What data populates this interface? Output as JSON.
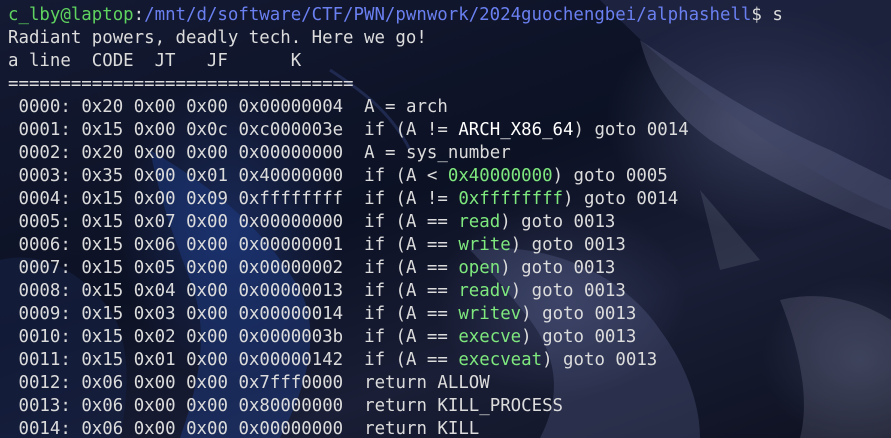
{
  "terminal": {
    "prompt": {
      "user_host": "c_lby@laptop",
      "colon": ":",
      "path": "/mnt/d/software/CTF/PWN/pwnwork/2024guochengbei/alphashell",
      "dollar": "$ ",
      "command": "s"
    },
    "banner": "Radiant powers, deadly tech. Here we go!",
    "header": "a line  CODE  JT   JF      K",
    "separator": "=================================",
    "rows": [
      {
        "num": " 0000:",
        "code": "0x20",
        "jt": "0x00",
        "jf": "0x00",
        "k": "0x00000004",
        "pre": "A = arch",
        "hl": "",
        "post": "",
        "hl_color": "none"
      },
      {
        "num": " 0001:",
        "code": "0x15",
        "jt": "0x00",
        "jf": "0x0c",
        "k": "0xc000003e",
        "pre": "if (A != ",
        "hl": "ARCH_X86_64",
        "post": ") goto 0014",
        "hl_color": "white"
      },
      {
        "num": " 0002:",
        "code": "0x20",
        "jt": "0x00",
        "jf": "0x00",
        "k": "0x00000000",
        "pre": "A = sys_number",
        "hl": "",
        "post": "",
        "hl_color": "none"
      },
      {
        "num": " 0003:",
        "code": "0x35",
        "jt": "0x00",
        "jf": "0x01",
        "k": "0x40000000",
        "pre": "if (A < ",
        "hl": "0x40000000",
        "post": ") goto 0005",
        "hl_color": "green"
      },
      {
        "num": " 0004:",
        "code": "0x15",
        "jt": "0x00",
        "jf": "0x09",
        "k": "0xffffffff",
        "pre": "if (A != ",
        "hl": "0xffffffff",
        "post": ") goto 0014",
        "hl_color": "green"
      },
      {
        "num": " 0005:",
        "code": "0x15",
        "jt": "0x07",
        "jf": "0x00",
        "k": "0x00000000",
        "pre": "if (A == ",
        "hl": "read",
        "post": ") goto 0013",
        "hl_color": "green"
      },
      {
        "num": " 0006:",
        "code": "0x15",
        "jt": "0x06",
        "jf": "0x00",
        "k": "0x00000001",
        "pre": "if (A == ",
        "hl": "write",
        "post": ") goto 0013",
        "hl_color": "green"
      },
      {
        "num": " 0007:",
        "code": "0x15",
        "jt": "0x05",
        "jf": "0x00",
        "k": "0x00000002",
        "pre": "if (A == ",
        "hl": "open",
        "post": ") goto 0013",
        "hl_color": "green"
      },
      {
        "num": " 0008:",
        "code": "0x15",
        "jt": "0x04",
        "jf": "0x00",
        "k": "0x00000013",
        "pre": "if (A == ",
        "hl": "readv",
        "post": ") goto 0013",
        "hl_color": "green"
      },
      {
        "num": " 0009:",
        "code": "0x15",
        "jt": "0x03",
        "jf": "0x00",
        "k": "0x00000014",
        "pre": "if (A == ",
        "hl": "writev",
        "post": ") goto 0013",
        "hl_color": "green"
      },
      {
        "num": " 0010:",
        "code": "0x15",
        "jt": "0x02",
        "jf": "0x00",
        "k": "0x0000003b",
        "pre": "if (A == ",
        "hl": "execve",
        "post": ") goto 0013",
        "hl_color": "green"
      },
      {
        "num": " 0011:",
        "code": "0x15",
        "jt": "0x01",
        "jf": "0x00",
        "k": "0x00000142",
        "pre": "if (A == ",
        "hl": "execveat",
        "post": ") goto 0013",
        "hl_color": "green"
      },
      {
        "num": " 0012:",
        "code": "0x06",
        "jt": "0x00",
        "jf": "0x00",
        "k": "0x7fff0000",
        "pre": "return ALLOW",
        "hl": "",
        "post": "",
        "hl_color": "none"
      },
      {
        "num": " 0013:",
        "code": "0x06",
        "jt": "0x00",
        "jf": "0x00",
        "k": "0x80000000",
        "pre": "return KILL_PROCESS",
        "hl": "",
        "post": "",
        "hl_color": "none"
      },
      {
        "num": " 0014:",
        "code": "0x06",
        "jt": "0x00",
        "jf": "0x00",
        "k": "0x00000000",
        "pre": "return KILL",
        "hl": "",
        "post": "",
        "hl_color": "none"
      }
    ]
  },
  "colors": {
    "prompt_user": "#5fd35f",
    "prompt_path": "#6a7ff0",
    "text": "#dcdcdc",
    "highlight_white": "#ffffff",
    "highlight_green": "#7ee87e",
    "background": "#0f1326"
  }
}
